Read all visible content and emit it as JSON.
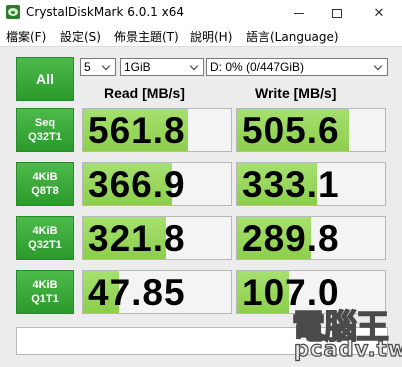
{
  "window": {
    "title": "CrystalDiskMark 6.0.1 x64",
    "close_glyph": "✕"
  },
  "menu": [
    {
      "label": "檔案(F)"
    },
    {
      "label": "設定(S)"
    },
    {
      "label": "佈景主題(T)"
    },
    {
      "label": "說明(H)"
    },
    {
      "label": "語言(Language)"
    }
  ],
  "controls": {
    "all_label": "All",
    "test_count": "5",
    "test_size": "1GiB",
    "drive": "D: 0% (0/447GiB)"
  },
  "headers": {
    "read": "Read [MB/s]",
    "write": "Write [MB/s]"
  },
  "tests": [
    {
      "line1": "Seq",
      "line2": "Q32T1",
      "read": "561.8",
      "write": "505.6",
      "read_fill": 0.71,
      "write_fill": 0.76
    },
    {
      "line1": "4KiB",
      "line2": "Q8T8",
      "read": "366.9",
      "write": "333.1",
      "read_fill": 0.6,
      "write_fill": 0.54
    },
    {
      "line1": "4KiB",
      "line2": "Q32T1",
      "read": "321.8",
      "write": "289.8",
      "read_fill": 0.56,
      "write_fill": 0.5
    },
    {
      "line1": "4KiB",
      "line2": "Q1T1",
      "read": "47.85",
      "write": "107.0",
      "read_fill": 0.24,
      "write_fill": 0.35
    }
  ],
  "comment": "",
  "watermark": {
    "chinese": "電腦王",
    "domain": "pcadv.tw"
  },
  "colors": {
    "button_green": "#3aaa3a",
    "bar_green": "#9ad85f",
    "result_bg": "#f4f4f4"
  }
}
